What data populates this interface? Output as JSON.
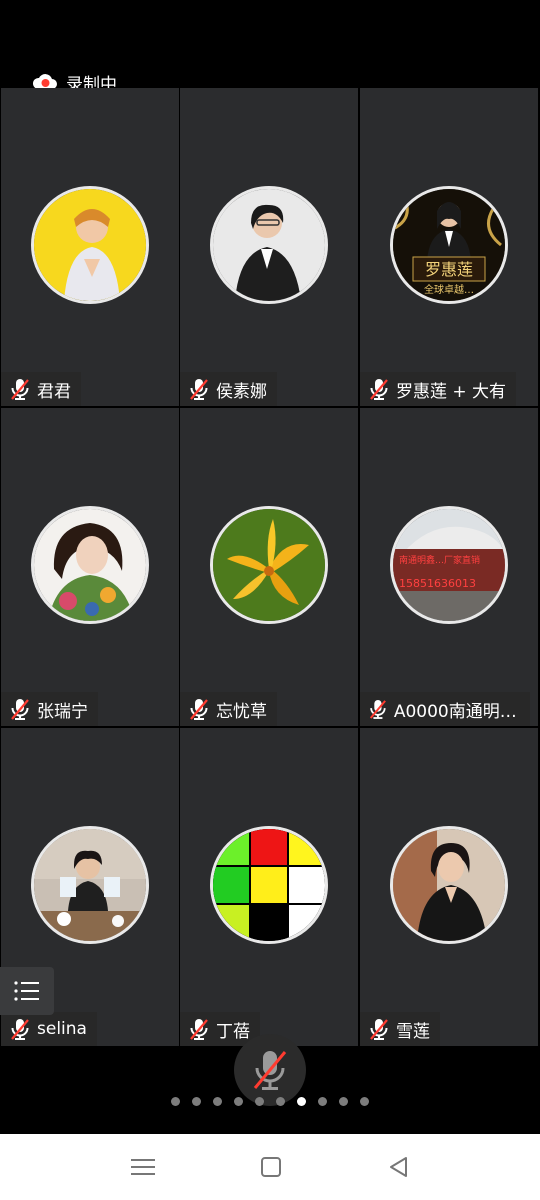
{
  "recording": {
    "label": "录制中",
    "icon": "cloud-record-icon",
    "color": "#ff3b30"
  },
  "participants": [
    {
      "name": "君君",
      "avatar_style": "yellow"
    },
    {
      "name": "侯素娜",
      "avatar_style": "grey"
    },
    {
      "name": "罗惠莲 + 大有",
      "avatar_style": "gold",
      "avatar_text": "罗惠莲",
      "avatar_subtext": "全球卓越…"
    },
    {
      "name": "张瑞宁",
      "avatar_style": "portrait"
    },
    {
      "name": "忘忧草",
      "avatar_style": "flower"
    },
    {
      "name": "A0000南通明鑫…",
      "avatar_style": "truck",
      "avatar_text": "南通明鑫…厂家直销",
      "avatar_subtext": "15851636013"
    },
    {
      "name": "selina",
      "avatar_style": "room"
    },
    {
      "name": "丁蓓",
      "avatar_style": "grid"
    },
    {
      "name": "雪莲",
      "avatar_style": "suit"
    }
  ],
  "pagination": {
    "total": 10,
    "active_index": 6
  },
  "colors": {
    "tile_bg": "#2b2c2e",
    "mic_muted": "#ff3b30"
  },
  "navbar": {
    "icons": [
      "menu-icon",
      "home-icon",
      "back-icon"
    ]
  }
}
